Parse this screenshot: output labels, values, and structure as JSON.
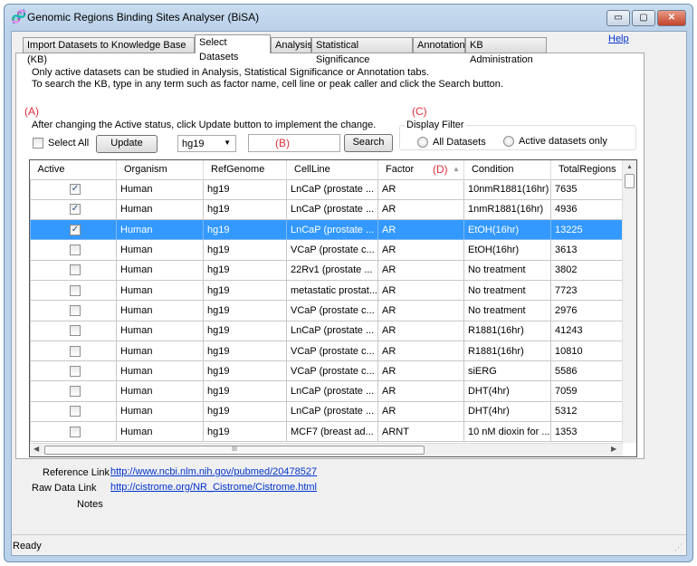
{
  "window": {
    "title": "Genomic Regions Binding Sites Analyser (BiSA)",
    "minimize": "▭",
    "maximize": "▢",
    "close": "✕"
  },
  "tabs": [
    {
      "label": "Import Datasets to Knowledge Base (KB)"
    },
    {
      "label": "Select Datasets",
      "selected": true
    },
    {
      "label": "Analysis"
    },
    {
      "label": "Statistical Significance"
    },
    {
      "label": "Annotation"
    },
    {
      "label": "KB Administration"
    }
  ],
  "help": "Help",
  "instructions": [
    "Only active datasets can be studied in Analysis, Statistical Significance or Annotation tabs.",
    "To search the KB, type in any term such as factor name, cell line or peak caller and click the Search button."
  ],
  "annotations": {
    "a": "(A)",
    "b": "(B)",
    "c": "(C)",
    "d": "(D)"
  },
  "update_note": "After changing the Active status, click Update button to implement the change.",
  "select_all": "Select All",
  "update_button": "Update",
  "genome_select": "hg19",
  "search_input": "",
  "search_button": "Search",
  "display_filter": {
    "label": "Display Filter",
    "options": [
      "All Datasets",
      "Active datasets only"
    ]
  },
  "grid": {
    "columns": [
      "Active",
      "Organism",
      "RefGenome",
      "CellLine",
      "Factor",
      "Condition",
      "TotalRegions"
    ],
    "sort_column": "Factor",
    "sort_dir": "ascending",
    "rows": [
      {
        "active": true,
        "organism": "Human",
        "ref": "hg19",
        "cell": "LnCaP (prostate ...",
        "factor": "AR",
        "cond": "10nmR1881(16hr)",
        "total": "7635"
      },
      {
        "active": true,
        "organism": "Human",
        "ref": "hg19",
        "cell": "LnCaP (prostate ...",
        "factor": "AR",
        "cond": "1nmR1881(16hr)",
        "total": "4936"
      },
      {
        "active": true,
        "organism": "Human",
        "ref": "hg19",
        "cell": "LnCaP (prostate ...",
        "factor": "AR",
        "cond": "EtOH(16hr)",
        "total": "13225",
        "selected": true
      },
      {
        "active": false,
        "organism": "Human",
        "ref": "hg19",
        "cell": "VCaP (prostate c...",
        "factor": "AR",
        "cond": "EtOH(16hr)",
        "total": "3613"
      },
      {
        "active": false,
        "organism": "Human",
        "ref": "hg19",
        "cell": "22Rv1 (prostate ...",
        "factor": "AR",
        "cond": "No treatment",
        "total": "3802"
      },
      {
        "active": false,
        "organism": "Human",
        "ref": "hg19",
        "cell": "metastatic prostat...",
        "factor": "AR",
        "cond": "No treatment",
        "total": "7723"
      },
      {
        "active": false,
        "organism": "Human",
        "ref": "hg19",
        "cell": "VCaP (prostate c...",
        "factor": "AR",
        "cond": "No treatment",
        "total": "2976"
      },
      {
        "active": false,
        "organism": "Human",
        "ref": "hg19",
        "cell": "LnCaP (prostate ...",
        "factor": "AR",
        "cond": "R1881(16hr)",
        "total": "41243"
      },
      {
        "active": false,
        "organism": "Human",
        "ref": "hg19",
        "cell": "VCaP (prostate c...",
        "factor": "AR",
        "cond": "R1881(16hr)",
        "total": "10810"
      },
      {
        "active": false,
        "organism": "Human",
        "ref": "hg19",
        "cell": "VCaP (prostate c...",
        "factor": "AR",
        "cond": "siERG",
        "total": "5586"
      },
      {
        "active": false,
        "organism": "Human",
        "ref": "hg19",
        "cell": "LnCaP (prostate ...",
        "factor": "AR",
        "cond": "DHT(4hr)",
        "total": "7059"
      },
      {
        "active": false,
        "organism": "Human",
        "ref": "hg19",
        "cell": "LnCaP (prostate ...",
        "factor": "AR",
        "cond": "DHT(4hr)",
        "total": "5312"
      },
      {
        "active": false,
        "organism": "Human",
        "ref": "hg19",
        "cell": "MCF7 (breast ad...",
        "factor": "ARNT",
        "cond": "10 nM dioxin for ...",
        "total": "1353"
      }
    ],
    "hscroll_grip": "III"
  },
  "details": {
    "reference_label": "Reference Link",
    "reference_url": "http://www.ncbi.nlm.nih.gov/pubmed/20478527",
    "raw_label": "Raw Data Link",
    "raw_url": "http://cistrome.org/NR_Cistrome/Cistrome.html",
    "notes_label": "Notes"
  },
  "status": "Ready",
  "colors": {
    "selection": "#3399ff",
    "annotation": "#e0303a",
    "link": "#0033cc"
  }
}
